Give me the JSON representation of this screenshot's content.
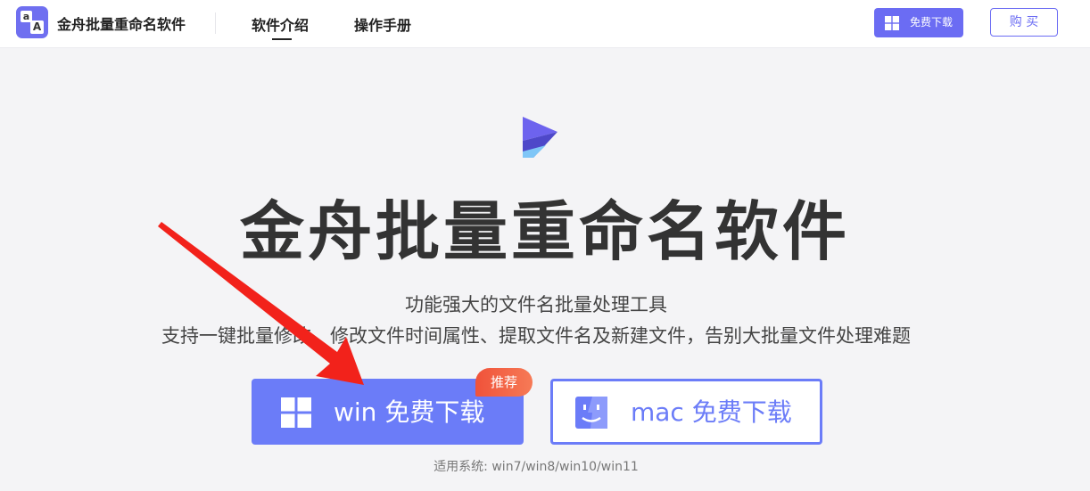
{
  "header": {
    "logo_tiles": [
      "a",
      "A"
    ],
    "app_name": "金舟批量重命名软件",
    "nav": [
      {
        "label": "软件介绍",
        "active": true
      },
      {
        "label": "操作手册",
        "active": false
      }
    ],
    "download_button": {
      "label": "免费下载",
      "icon": "windows-icon"
    },
    "buy_button": {
      "label": "购 买"
    }
  },
  "hero": {
    "title": "金舟批量重命名软件",
    "subtitle_line1": "功能强大的文件名批量处理工具",
    "subtitle_line2": "支持一键批量修改、修改文件时间属性、提取文件名及新建文件，告别大批量文件处理难题",
    "win_button": {
      "label": "win 免费下载",
      "icon": "windows-icon",
      "badge": "推荐"
    },
    "mac_button": {
      "label": "mac 免费下载",
      "icon": "finder-icon"
    },
    "compatibility": "适用系统: win7/win8/win10/win11"
  },
  "colors": {
    "accent": "#6b6cf3",
    "button_primary": "#6b7cf8",
    "badge": "#f0523a",
    "annotation_arrow": "#f2221b"
  }
}
